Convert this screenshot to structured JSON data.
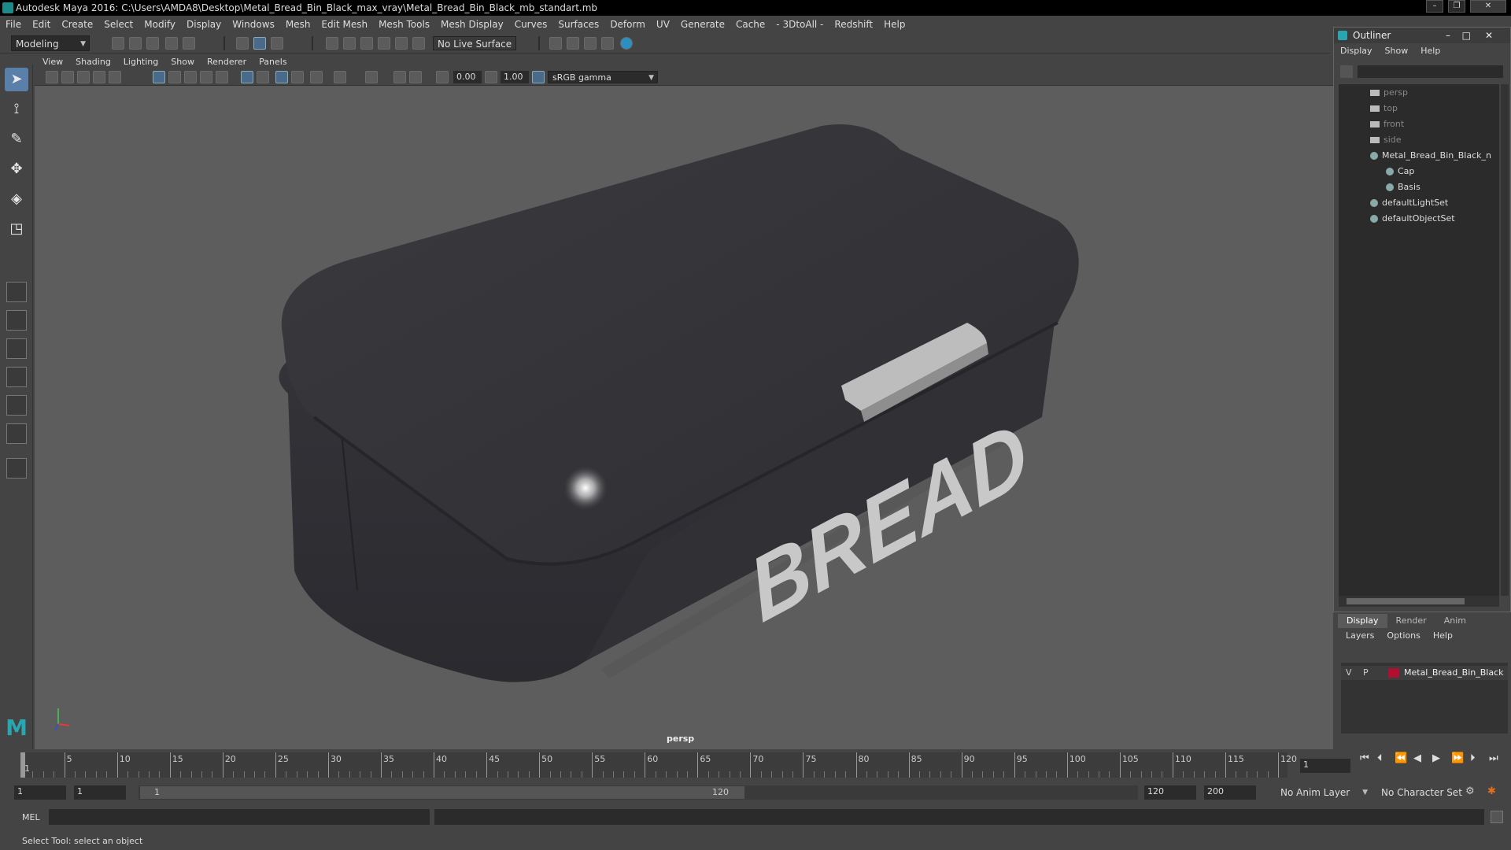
{
  "window": {
    "title": "Autodesk Maya 2016: C:\\Users\\AMDA8\\Desktop\\Metal_Bread_Bin_Black_max_vray\\Metal_Bread_Bin_Black_mb_standart.mb",
    "controls": [
      "minimize-icon",
      "restore-icon",
      "close-icon"
    ]
  },
  "menubar": [
    "File",
    "Edit",
    "Create",
    "Select",
    "Modify",
    "Display",
    "Windows",
    "Mesh",
    "Edit Mesh",
    "Mesh Tools",
    "Mesh Display",
    "Curves",
    "Surfaces",
    "Deform",
    "UV",
    "Generate",
    "Cache",
    "- 3DtoAll -",
    "Redshift",
    "Help"
  ],
  "shelf": {
    "mode": "Modeling",
    "live_surface": "No Live Surface"
  },
  "panel": {
    "menus": [
      "View",
      "Shading",
      "Lighting",
      "Show",
      "Renderer",
      "Panels"
    ],
    "field1": "0.00",
    "field2": "1.00",
    "color_space": "sRGB gamma"
  },
  "viewport": {
    "camera_label": "persp",
    "object_text": "BREAD"
  },
  "outliner": {
    "title": "Outliner",
    "menus": [
      "Display",
      "Show",
      "Help"
    ],
    "items": [
      {
        "label": "persp",
        "icon": "camera-icon",
        "dim": true
      },
      {
        "label": "top",
        "icon": "camera-icon",
        "dim": true
      },
      {
        "label": "front",
        "icon": "camera-icon",
        "dim": true
      },
      {
        "label": "side",
        "icon": "camera-icon",
        "dim": true
      },
      {
        "label": "Metal_Bread_Bin_Black_n",
        "icon": "group-icon",
        "dim": false
      },
      {
        "label": "Cap",
        "icon": "mesh-icon",
        "dim": false
      },
      {
        "label": "Basis",
        "icon": "mesh-icon",
        "dim": false
      },
      {
        "label": "defaultLightSet",
        "icon": "set-icon",
        "dim": false
      },
      {
        "label": "defaultObjectSet",
        "icon": "set-icon",
        "dim": false
      }
    ]
  },
  "layers": {
    "tabs": [
      "Display",
      "Render",
      "Anim"
    ],
    "menus": [
      "Layers",
      "Options",
      "Help"
    ],
    "row": {
      "v": "V",
      "p": "P",
      "name": "Metal_Bread_Bin_Black",
      "color": "#b01030"
    }
  },
  "timeline": {
    "ticks": [
      "1",
      "5",
      "10",
      "15",
      "20",
      "25",
      "30",
      "35",
      "40",
      "45",
      "50",
      "55",
      "60",
      "65",
      "70",
      "75",
      "80",
      "85",
      "90",
      "95",
      "100",
      "105",
      "110",
      "115",
      "120"
    ],
    "current_frame": "1"
  },
  "range": {
    "start": "1",
    "playback_start": "1",
    "slider_start": "1",
    "slider_end": "120",
    "playback_end": "120",
    "end": "200",
    "anim_layer": "No Anim Layer",
    "character_set": "No Character Set"
  },
  "cmdline": {
    "label": "MEL"
  },
  "helpline": {
    "text": "Select Tool: select an object"
  },
  "colors": {
    "accent": "#5a7fa8",
    "background": "#444444",
    "viewport": "#5d5d5d"
  }
}
